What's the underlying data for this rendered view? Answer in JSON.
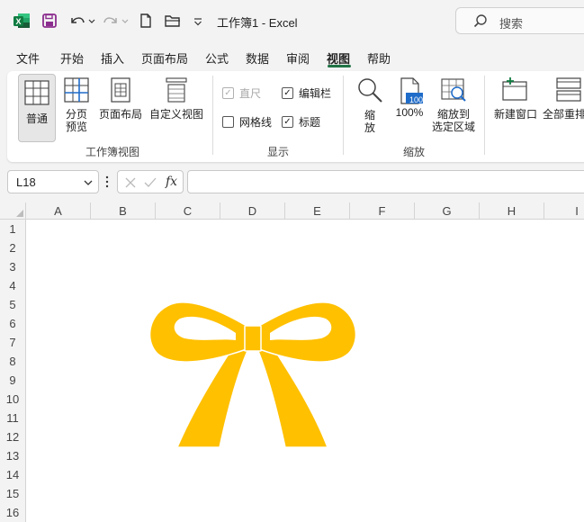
{
  "titlebar": {
    "title": "工作簿1  -  Excel",
    "search_placeholder": "搜索"
  },
  "menu": [
    "文件",
    "开始",
    "插入",
    "页面布局",
    "公式",
    "数据",
    "审阅",
    "视图",
    "帮助"
  ],
  "menu_active": "视图",
  "ribbon": {
    "workbook_views": {
      "normal": "普通",
      "page_break_1": "分页",
      "page_break_2": "预览",
      "page_layout": "页面布局",
      "custom_views": "自定义视图",
      "group_label": "工作簿视图"
    },
    "show": {
      "ruler": "直尺",
      "formula_bar": "编辑栏",
      "gridlines": "网格线",
      "headings": "标题",
      "ruler_checked": true,
      "formula_bar_checked": true,
      "gridlines_checked": false,
      "headings_checked": true,
      "group_label": "显示"
    },
    "zoom": {
      "zoom_1": "缩",
      "zoom_2": "放",
      "hundred": "100%",
      "hundred_badge": "100",
      "selection_1": "缩放到",
      "selection_2": "选定区域",
      "group_label": "缩放"
    },
    "window": {
      "new_window": "新建窗口",
      "arrange_all": "全部重排"
    }
  },
  "formula_bar": {
    "name_box": "L18",
    "fx": "fx",
    "value": ""
  },
  "grid": {
    "columns": [
      "A",
      "B",
      "C",
      "D",
      "E",
      "F",
      "G",
      "H",
      "I"
    ],
    "rows": [
      "1",
      "2",
      "3",
      "4",
      "5",
      "6",
      "7",
      "8",
      "9",
      "10",
      "11",
      "12",
      "13",
      "14",
      "15",
      "16"
    ]
  },
  "shape": {
    "type": "bow",
    "color": "#FFC000"
  },
  "colors": {
    "accent": "#217346",
    "excel_green": "#107C41",
    "save_purple": "#8B2D8E",
    "zoom_blue": "#1F6CC9"
  }
}
